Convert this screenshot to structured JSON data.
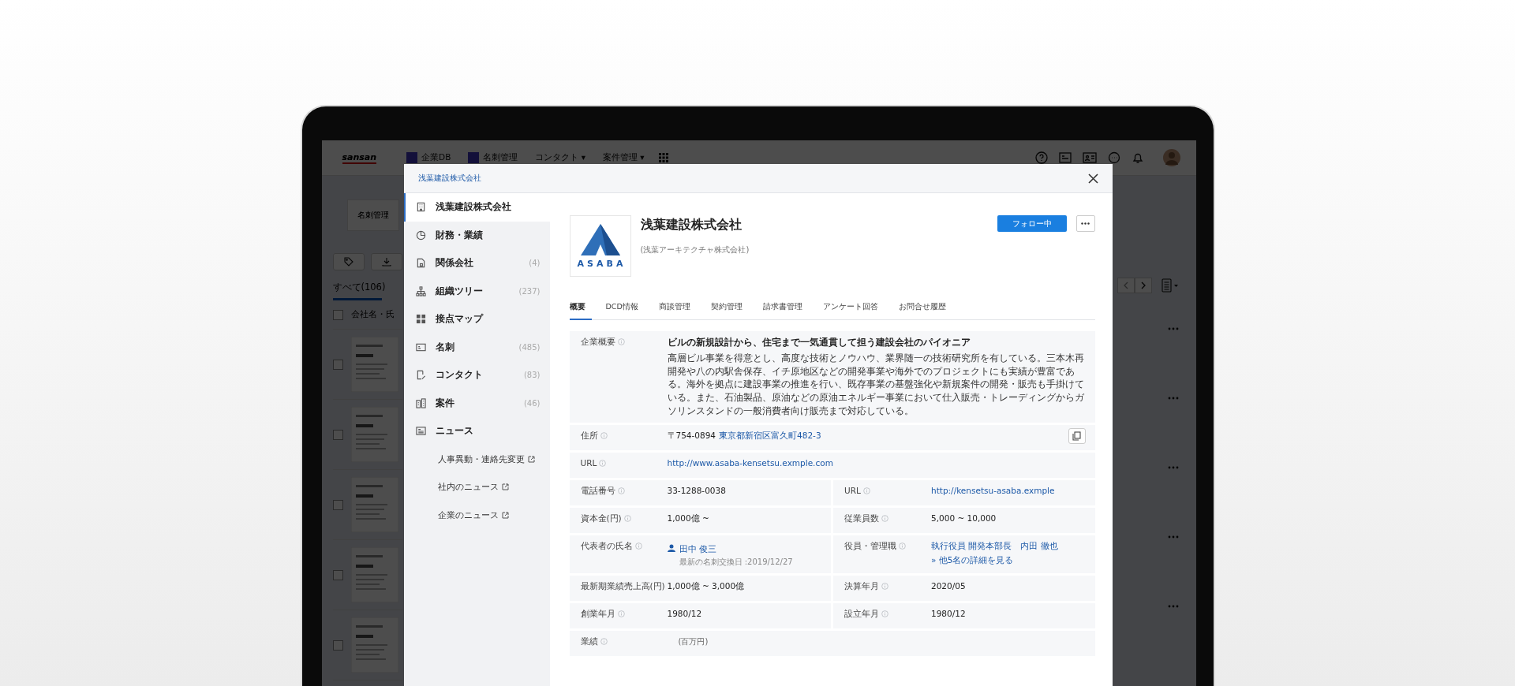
{
  "app_header": {
    "logo": "sansan",
    "nav": [
      {
        "label": "企業DB",
        "kind": "app"
      },
      {
        "label": "名刺管理",
        "kind": "app"
      },
      {
        "label": "コンタクト ▾",
        "kind": "menu"
      },
      {
        "label": "案件管理 ▾",
        "kind": "menu"
      }
    ]
  },
  "background_list": {
    "page_button": "名刺管理",
    "tab": "すべて(106)",
    "column_header": "会社名・氏",
    "header_checked": false,
    "rows": [
      {
        "checked": false
      },
      {
        "checked": false
      },
      {
        "checked": false
      },
      {
        "checked": false
      },
      {
        "checked": false
      }
    ]
  },
  "modal": {
    "title": "浅葉建設株式会社",
    "sidebar": [
      {
        "label": "浅葉建設株式会社",
        "kind": "building",
        "selected": true
      },
      {
        "label": "財務・業績",
        "kind": "chart",
        "selected": false
      },
      {
        "label": "関係会社",
        "count": "(4)",
        "kind": "document",
        "selected": false
      },
      {
        "label": "組織ツリー",
        "count": "(237)",
        "kind": "tree",
        "selected": false
      },
      {
        "label": "接点マップ",
        "kind": "grid",
        "selected": false
      },
      {
        "label": "名刺",
        "count": "(485)",
        "kind": "card",
        "selected": false
      },
      {
        "label": "コンタクト",
        "count": "(83)",
        "kind": "contact",
        "selected": false
      },
      {
        "label": "案件",
        "count": "(46)",
        "kind": "project",
        "selected": false
      },
      {
        "label": "ニュース",
        "kind": "news",
        "selected": false
      }
    ],
    "news_links": [
      "人事異動・連絡先変更",
      "社内のニュース",
      "企業のニュース"
    ],
    "company": {
      "name": "浅葉建設株式会社",
      "sub_name": "(浅葉アーキテクチャ株式会社)",
      "logo_text": "ASABA",
      "follow_button": "フォロー中"
    },
    "tabs": [
      {
        "label": "概要",
        "selected": true
      },
      {
        "label": "DCD情報",
        "selected": false
      },
      {
        "label": "商談管理",
        "selected": false
      },
      {
        "label": "契約管理",
        "selected": false
      },
      {
        "label": "請求書管理",
        "selected": false
      },
      {
        "label": "アンケート回答",
        "selected": false
      },
      {
        "label": "お問合せ履歴",
        "selected": false
      }
    ],
    "details": [
      {
        "cells": [
          {
            "label": "企業概要",
            "kind": "summary",
            "headline": "ビルの新規設計から、住宅まで一気通貫して担う建設会社のパイオニア",
            "body": "高層ビル事業を得意とし、高度な技術とノウハウ、業界随一の技術研究所を有している。三本木再開発や八の内駅舎保存、イチ原地区などの開発事業や海外でのプロジェクトにも実績が豊富である。海外を拠点に建設事業の推進を行い、既存事業の基盤強化や新規案件の開発・販売も手掛けている。また、石油製品、原油などの原油エネルギー事業において仕入販売・トレーディングからガソリンスタンドの一般消費者向け販売まで対応している。"
          }
        ]
      },
      {
        "cells": [
          {
            "label": "住所",
            "kind": "address",
            "postal": "〒754-0894",
            "value": "東京都新宿区富久町482-3"
          }
        ]
      },
      {
        "cells": [
          {
            "label": "URL",
            "kind": "link",
            "value": "http://www.asaba-kensetsu.exmple.com"
          }
        ]
      },
      {
        "cells": [
          {
            "label": "電話番号",
            "kind": "text",
            "value": "33-1288-0038"
          },
          {
            "label": "URL",
            "kind": "link",
            "value": "http://kensetsu-asaba.exmple"
          }
        ]
      },
      {
        "cells": [
          {
            "label": "資本金(円)",
            "kind": "text",
            "value": "1,000億 ~"
          },
          {
            "label": "従業員数",
            "kind": "text",
            "value": "5,000 ~ 10,000"
          }
        ]
      },
      {
        "cells": [
          {
            "label": "代表者の氏名",
            "kind": "person",
            "value": "田中 俊三",
            "note": "最新の名刺交換日 :2019/12/27"
          },
          {
            "label": "役員・管理職",
            "kind": "links",
            "values": [
              "執行役員 開発本部長　内田 徹也",
              "» 他5名の詳細を見る"
            ]
          }
        ]
      },
      {
        "cells": [
          {
            "label": "最新期業績売上高(円)",
            "kind": "text",
            "value": "1,000億 ~ 3,000億"
          },
          {
            "label": "決算年月",
            "kind": "text",
            "value": "2020/05"
          }
        ]
      },
      {
        "cells": [
          {
            "label": "創業年月",
            "kind": "text",
            "value": "1980/12"
          },
          {
            "label": "設立年月",
            "kind": "text",
            "value": "1980/12"
          }
        ]
      },
      {
        "cells": [
          {
            "label": "業績",
            "kind": "unit",
            "value": "(百万円)"
          }
        ]
      }
    ]
  }
}
